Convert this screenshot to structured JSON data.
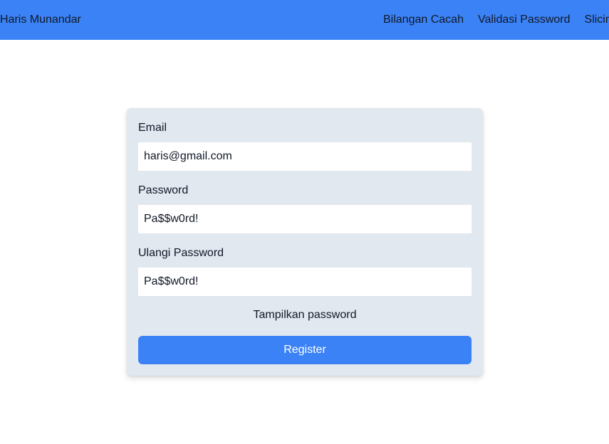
{
  "navbar": {
    "brand": "Haris Munandar",
    "links": [
      {
        "label": "Bilangan Cacah"
      },
      {
        "label": "Validasi Password"
      },
      {
        "label": "Slicing"
      }
    ]
  },
  "form": {
    "email": {
      "label": "Email",
      "value": "haris@gmail.com"
    },
    "password": {
      "label": "Password",
      "value": "Pa$$w0rd!"
    },
    "confirm_password": {
      "label": "Ulangi Password",
      "value": "Pa$$w0rd!"
    },
    "show_password_label": "Tampilkan password",
    "submit_label": "Register"
  },
  "colors": {
    "primary": "#3b82f6",
    "card_background": "#e2e8f0",
    "text": "#111827"
  }
}
